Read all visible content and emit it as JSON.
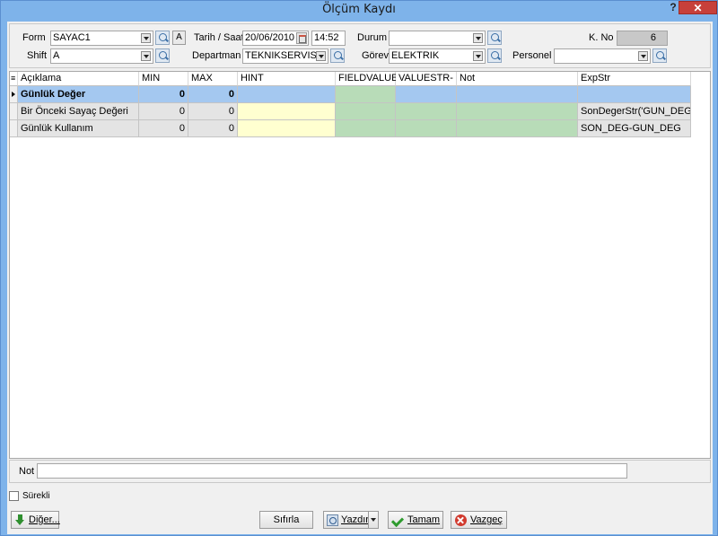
{
  "window": {
    "title": "Ölçüm Kaydı",
    "help_glyph": "?",
    "close_glyph": "✕"
  },
  "header": {
    "form_label": "Form",
    "form_value": "SAYAC1",
    "a_button_label": "A",
    "date_label": "Tarih / Saat",
    "date_value": "20/06/2010",
    "time_value": "14:52",
    "status_label": "Durum",
    "status_value": "",
    "kno_label": "K. No",
    "kno_value": "6",
    "shift_label": "Shift",
    "shift_value": "A",
    "department_label": "Departman",
    "department_value": "TEKNIKSERVIS_",
    "duty_label": "Görev",
    "duty_value": "ELEKTRIK",
    "personnel_label": "Personel",
    "personnel_value": ""
  },
  "grid": {
    "row_selector_glyph": "≡",
    "columns": [
      "Açıklama",
      "MIN",
      "MAX",
      "HINT",
      "FIELDVALUE-",
      "VALUESTR-",
      "Not",
      "ExpStr"
    ],
    "rows": [
      {
        "desc": "Günlük Değer",
        "min": "0",
        "max": "0",
        "hint": "",
        "fieldvalue": "",
        "valuestr": "",
        "not": "",
        "expstr": ""
      },
      {
        "desc": "Bir Önceki Sayaç Değeri",
        "min": "0",
        "max": "0",
        "hint": "",
        "fieldvalue": "",
        "valuestr": "",
        "not": "",
        "expstr": "SonDegerStr('GUN_DEG')"
      },
      {
        "desc": "Günlük Kullanım",
        "min": "0",
        "max": "0",
        "hint": "",
        "fieldvalue": "",
        "valuestr": "",
        "not": "",
        "expstr": "SON_DEG-GUN_DEG"
      }
    ]
  },
  "note": {
    "label": "Not",
    "value": ""
  },
  "footer": {
    "continuous_label": "Sürekli",
    "other_button": "Diğer...",
    "reset_button": "Sıfırla",
    "print_button": "Yazdır",
    "ok_button": "Tamam",
    "cancel_button": "Vazgeç"
  },
  "colors": {
    "selected_row": "#a4c8f0",
    "hint_cell": "#ffffd0",
    "value_cell": "#b8dcb8",
    "kno_field": "#c8c8c8"
  }
}
